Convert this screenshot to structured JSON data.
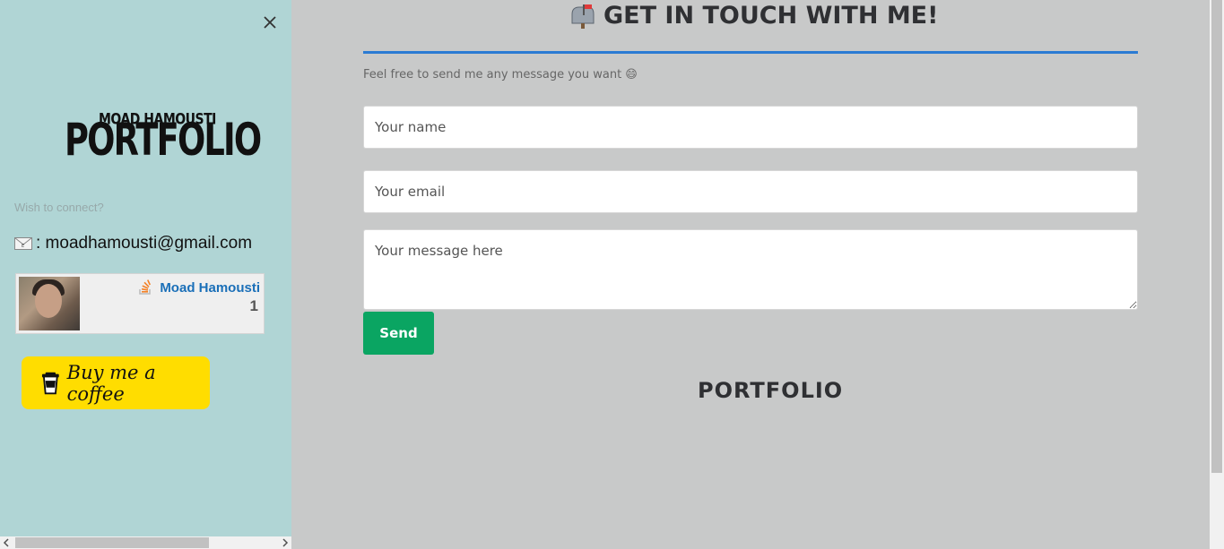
{
  "sidebar": {
    "close_glyph": "×",
    "logo_top": "MOAD HAMOUSTI",
    "logo_main": "PORTFOLIO",
    "wish_text": "Wish to connect?",
    "email": ": moadhamousti@gmail.com",
    "stackoverflow": {
      "name": "Moad Hamousti",
      "reputation": "1"
    },
    "coffee_label": "Buy me a coffee"
  },
  "main": {
    "heading": "GET IN TOUCH WITH ME!",
    "subtitle": "Feel free to send me any message you want",
    "subtitle_emoji": "😄",
    "form": {
      "name_placeholder": "Your name",
      "email_placeholder": "Your email",
      "message_placeholder": "Your message here",
      "send_label": "Send"
    },
    "footer_logo": "PORTFOLIO"
  },
  "colors": {
    "sidebar_bg": "#b0d5d5",
    "main_bg": "#c8c9c9",
    "accent_line": "#2b7bd3",
    "send_button": "#0aa562",
    "coffee_button": "#ffdd00",
    "so_link": "#1a6fb8"
  },
  "icons": [
    "close-icon",
    "mailbox-icon",
    "envelope-icon",
    "stackoverflow-icon",
    "coffee-cup-icon",
    "grin-emoji-icon"
  ]
}
